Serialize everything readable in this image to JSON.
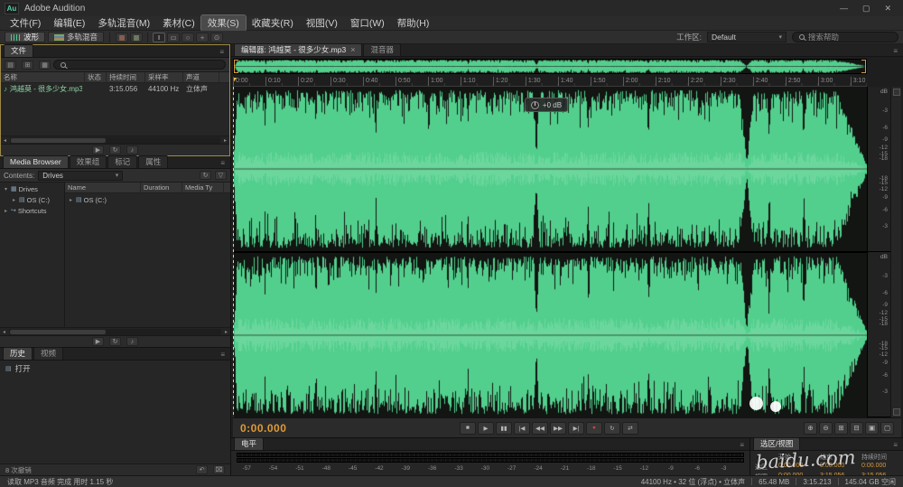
{
  "titlebar": {
    "logo": "Au",
    "title": "Adobe Audition",
    "minimize": "—",
    "maximize": "▢",
    "close": "✕"
  },
  "menubar": {
    "items": [
      {
        "name": "file",
        "label": "文件(F)",
        "active": false
      },
      {
        "name": "edit",
        "label": "编辑(E)",
        "active": false
      },
      {
        "name": "multitrack",
        "label": "多轨混音(M)",
        "active": false
      },
      {
        "name": "clip",
        "label": "素材(C)",
        "active": false
      },
      {
        "name": "effects",
        "label": "效果(S)",
        "active": true
      },
      {
        "name": "favorites",
        "label": "收藏夹(R)",
        "active": false
      },
      {
        "name": "view",
        "label": "视图(V)",
        "active": false
      },
      {
        "name": "window",
        "label": "窗口(W)",
        "active": false
      },
      {
        "name": "help",
        "label": "帮助(H)",
        "active": false
      }
    ]
  },
  "toolbar": {
    "view_buttons": [
      {
        "label": "波形",
        "active": true
      },
      {
        "label": "多轨混音",
        "active": false
      }
    ],
    "tool_icons": [
      {
        "name": "spectral-frequency-display-icon",
        "glyph": "▦",
        "color": "#b4705c"
      },
      {
        "name": "spectral-pitch-display-icon",
        "glyph": "▦",
        "color": "#8a9a7a"
      },
      {
        "sep": true
      },
      {
        "name": "time-selection-tool-icon",
        "glyph": "I",
        "active": true
      },
      {
        "name": "marquee-selection-tool-icon",
        "glyph": "▭"
      },
      {
        "name": "lasso-selection-tool-icon",
        "glyph": "○"
      },
      {
        "name": "paintbrush-selection-tool-icon",
        "glyph": "+"
      },
      {
        "name": "spot-healing-brush-tool-icon",
        "glyph": "⊙"
      }
    ],
    "workspace_label": "工作区:",
    "workspace_value": "Default",
    "search_placeholder": "搜索帮助"
  },
  "files_panel": {
    "tab": "文件",
    "toolbar_icons": [
      {
        "name": "open-file-icon",
        "glyph": "▤"
      },
      {
        "name": "import-file-icon",
        "glyph": "⊞"
      },
      {
        "name": "new-content-icon",
        "glyph": "▦"
      }
    ],
    "columns": [
      "名称",
      "状态",
      "持续时间",
      "采样率",
      "声道"
    ],
    "file": {
      "name": "鸿越莫 - 很多少女.mp3",
      "status": "",
      "duration": "3:15.056",
      "sample_rate": "44100 Hz",
      "channels": "立体声"
    },
    "footer_icons": [
      {
        "name": "play-file-icon",
        "glyph": "▶"
      },
      {
        "name": "loop-playback-icon",
        "glyph": "↻"
      },
      {
        "name": "auto-play-icon",
        "glyph": "♪"
      }
    ]
  },
  "media_browser": {
    "tabs": [
      {
        "name": "media-browser",
        "label": "Media Browser",
        "active": true
      },
      {
        "name": "effects-rack",
        "label": "效果组",
        "active": false
      },
      {
        "name": "markers",
        "label": "标记",
        "active": false
      },
      {
        "name": "properties",
        "label": "属性",
        "active": false
      }
    ],
    "contents_label": "Contents:",
    "contents_value": "Drives",
    "header_icons": [
      {
        "name": "refresh-icon",
        "glyph": "↻"
      },
      {
        "name": "filter-icon",
        "glyph": "▽"
      }
    ],
    "tree": [
      {
        "label": "Drives",
        "level": 0,
        "expanded": true,
        "icon_name": "computer-icon",
        "glyph": "▦"
      },
      {
        "label": "OS (C:)",
        "level": 1,
        "expanded": false,
        "icon_name": "drive-icon",
        "glyph": "▤"
      },
      {
        "label": "Shortcuts",
        "level": 0,
        "expanded": false,
        "icon_name": "shortcut-icon",
        "glyph": "↪"
      }
    ],
    "columns": [
      "Name",
      "Duration",
      "Media Ty"
    ],
    "rows": [
      {
        "name": "OS (C:)",
        "glyph": "▤"
      }
    ],
    "footer_icons": [
      {
        "name": "play-file-icon",
        "glyph": "▶"
      },
      {
        "name": "loop-playback-icon",
        "glyph": "↻"
      },
      {
        "name": "auto-play-icon",
        "glyph": "♪"
      }
    ]
  },
  "history_panel": {
    "tabs": [
      {
        "name": "history",
        "label": "历史",
        "active": true
      },
      {
        "name": "video",
        "label": "视频",
        "active": false
      }
    ],
    "items": [
      {
        "label": "打开"
      }
    ],
    "footer": "8 次撤销",
    "footer_icons": [
      {
        "name": "undo-icon",
        "glyph": "↶"
      },
      {
        "name": "clear-history-icon",
        "glyph": "⌧"
      }
    ]
  },
  "editor": {
    "tabs": [
      {
        "name": "editor",
        "label": "编辑器: 鸿越莫 - 很多少女.mp3",
        "active": true,
        "closable": true
      },
      {
        "name": "mixer",
        "label": "混音器",
        "active": false,
        "closable": false
      }
    ],
    "hud_value": "+0 dB",
    "timeline": {
      "duration_sec": 195.056,
      "labels": [
        "0:00",
        "0:10",
        "0:20",
        "0:30",
        "0:40",
        "0:50",
        "1:00",
        "1:10",
        "1:20",
        "1:30",
        "1:40",
        "1:50",
        "2:00",
        "2:10",
        "2:20",
        "2:30",
        "2:40",
        "2:50",
        "3:00",
        "3:10"
      ]
    },
    "db_scale_header": "dB",
    "db_labels": [
      {
        "t": "-3",
        "p": 0.146
      },
      {
        "t": "-6",
        "p": 0.25
      },
      {
        "t": "-9",
        "p": 0.323
      },
      {
        "t": "-12",
        "p": 0.374
      },
      {
        "t": "-15",
        "p": 0.411
      },
      {
        "t": "-18",
        "p": 0.437
      },
      {
        "t": "-18",
        "p": 0.563
      },
      {
        "t": "-15",
        "p": 0.589
      },
      {
        "t": "-12",
        "p": 0.626
      },
      {
        "t": "-9",
        "p": 0.677
      },
      {
        "t": "-6",
        "p": 0.75
      },
      {
        "t": "-3",
        "p": 0.854
      }
    ]
  },
  "transport": {
    "time": "0:00.000",
    "buttons": [
      {
        "name": "stop-button",
        "glyph": "■"
      },
      {
        "name": "play-button",
        "glyph": "▶"
      },
      {
        "name": "pause-button",
        "glyph": "▮▮"
      },
      {
        "name": "skip-to-start-button",
        "glyph": "|◀"
      },
      {
        "name": "rewind-button",
        "glyph": "◀◀"
      },
      {
        "name": "fast-forward-button",
        "glyph": "▶▶"
      },
      {
        "name": "skip-to-end-button",
        "glyph": "▶|"
      },
      {
        "name": "record-button",
        "glyph": "●",
        "color": "#d04545"
      },
      {
        "name": "loop-playback-button",
        "glyph": "↻"
      },
      {
        "name": "skip-selection-button",
        "glyph": "⇄"
      }
    ],
    "zoom_buttons": [
      {
        "name": "zoom-in-button",
        "glyph": "⊕"
      },
      {
        "name": "zoom-out-button",
        "glyph": "⊖"
      },
      {
        "name": "zoom-in-vertical-button",
        "glyph": "⊞"
      },
      {
        "name": "zoom-out-vertical-button",
        "glyph": "⊟"
      },
      {
        "name": "zoom-to-selection-button",
        "glyph": "▣"
      },
      {
        "name": "zoom-full-button",
        "glyph": "▢"
      }
    ]
  },
  "levels_panel": {
    "tab": "电平",
    "scale": [
      "-57",
      "-54",
      "-51",
      "-48",
      "-45",
      "-42",
      "-39",
      "-36",
      "-33",
      "-30",
      "-27",
      "-24",
      "-21",
      "-18",
      "-15",
      "-12",
      "-9",
      "-6",
      "-3"
    ]
  },
  "selection_view_panel": {
    "tab": "选区/视图",
    "columns": [
      "开始",
      "结束",
      "持续时间"
    ],
    "rows": [
      {
        "label": "选区",
        "start": "0:00.000",
        "end": "0:00.000",
        "duration": "0:00.000"
      },
      {
        "label": "视图",
        "start": "0:00.000",
        "end": "3:15.056",
        "duration": "3:15.056"
      }
    ]
  },
  "statusbar": {
    "left": "读取 MP3 音频 完成 用时 1.15 秒",
    "right": [
      "44100 Hz • 32 位 (浮点) • 立体声",
      "65.48 MB",
      "3:15.213",
      "145.04 GB 空闲"
    ]
  },
  "watermark": {
    "text": "baidu.com"
  },
  "colors": {
    "accent_orange": "#e8a33d",
    "wave_green": "#53cf8d",
    "record_red": "#d04545"
  }
}
